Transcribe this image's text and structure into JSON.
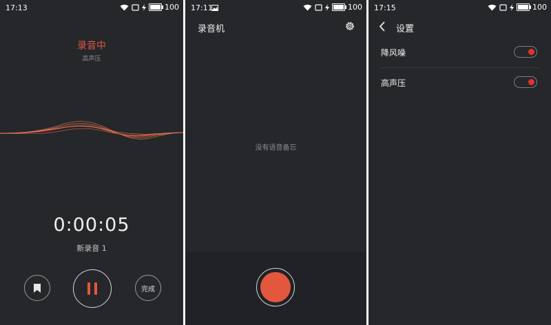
{
  "screens": {
    "recording": {
      "status": {
        "time": "17:13",
        "battery": "100"
      },
      "title": "录音中",
      "subtitle": "高声压",
      "timer": "0:00:05",
      "recording_name": "新录音 1",
      "done_label": "完成",
      "accent_color": "#e4573f"
    },
    "recorder_home": {
      "status": {
        "time": "17:11",
        "battery": "100"
      },
      "title": "录音机",
      "empty_text": "没有语音备忘"
    },
    "settings": {
      "status": {
        "time": "17:15",
        "battery": "100"
      },
      "title": "设置",
      "items": [
        {
          "label": "降风噪",
          "enabled": true
        },
        {
          "label": "高声压",
          "enabled": true
        }
      ]
    }
  }
}
